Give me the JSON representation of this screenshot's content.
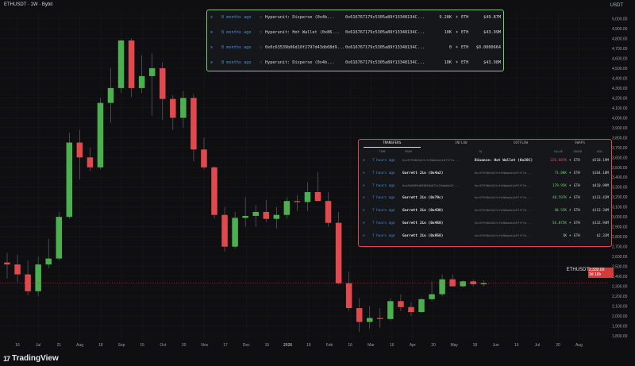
{
  "header": {
    "symbol": "ETHUSDT",
    "interval": "1W",
    "exchange": "Bybit",
    "title": "ETHUSDT · 1W · Bybit",
    "unit": "USDT"
  },
  "footer": {
    "brand": "TradingView"
  },
  "price_label": {
    "symbol": "ETHUSDT",
    "price": "2,332.00",
    "countdown": "3d 16h"
  },
  "chart_data": {
    "type": "candlestick",
    "title": "",
    "y_ticks": [
      "1,800.00",
      "1,900.00",
      "2,000.00",
      "2,100.00",
      "2,200.00",
      "2,300.00",
      "2,400.00",
      "2,500.00",
      "2,600.00",
      "2,700.00",
      "2,800.00",
      "2,900.00",
      "3,000.00",
      "3,100.00",
      "3,200.00",
      "3,300.00",
      "3,400.00",
      "3,500.00",
      "3,600.00",
      "3,700.00",
      "3,800.00",
      "3,900.00",
      "4,000.00",
      "4,100.00",
      "4,200.00",
      "4,300.00",
      "4,400.00",
      "4,500.00",
      "4,600.00",
      "4,700.00",
      "4,800.00",
      "4,900.00",
      "5,000.00"
    ],
    "ylim": [
      1760,
      5060
    ],
    "x_ticks": [
      "16",
      "Jul",
      "21",
      "Aug",
      "18",
      "Sep",
      "15",
      "Oct",
      "20",
      "Nov",
      "17",
      "Dec",
      "15",
      "2026",
      "19",
      "Feb",
      "16",
      "Mar",
      "16",
      "Apr",
      "20",
      "May",
      "18",
      "Jun",
      "15",
      "Jul",
      "20",
      "Aug"
    ],
    "candles": [
      {
        "o": 2540,
        "h": 2640,
        "l": 2380,
        "c": 2520
      },
      {
        "o": 2520,
        "h": 2620,
        "l": 2340,
        "c": 2420
      },
      {
        "o": 2420,
        "h": 2560,
        "l": 2210,
        "c": 2250
      },
      {
        "o": 2250,
        "h": 2600,
        "l": 2200,
        "c": 2520
      },
      {
        "o": 2520,
        "h": 2780,
        "l": 2480,
        "c": 2580
      },
      {
        "o": 2580,
        "h": 3050,
        "l": 2560,
        "c": 3000
      },
      {
        "o": 3000,
        "h": 3850,
        "l": 2980,
        "c": 3750
      },
      {
        "o": 3750,
        "h": 3880,
        "l": 3380,
        "c": 3600
      },
      {
        "o": 3600,
        "h": 3700,
        "l": 3460,
        "c": 3500
      },
      {
        "o": 3500,
        "h": 4200,
        "l": 3480,
        "c": 4150
      },
      {
        "o": 4150,
        "h": 4500,
        "l": 3950,
        "c": 4300
      },
      {
        "o": 4300,
        "h": 4790,
        "l": 4250,
        "c": 4780
      },
      {
        "o": 4780,
        "h": 4800,
        "l": 4210,
        "c": 4300
      },
      {
        "o": 4300,
        "h": 4630,
        "l": 4250,
        "c": 4420
      },
      {
        "o": 4420,
        "h": 4650,
        "l": 4020,
        "c": 4500
      },
      {
        "o": 4500,
        "h": 4560,
        "l": 3980,
        "c": 4190
      },
      {
        "o": 4190,
        "h": 4230,
        "l": 3880,
        "c": 4000
      },
      {
        "o": 4000,
        "h": 4270,
        "l": 3900,
        "c": 4200
      },
      {
        "o": 4200,
        "h": 4240,
        "l": 3560,
        "c": 3680
      },
      {
        "o": 3680,
        "h": 3800,
        "l": 3480,
        "c": 3500
      },
      {
        "o": 3500,
        "h": 3510,
        "l": 2980,
        "c": 3020
      },
      {
        "o": 3020,
        "h": 3100,
        "l": 2650,
        "c": 2700
      },
      {
        "o": 2700,
        "h": 3050,
        "l": 2680,
        "c": 2990
      },
      {
        "o": 2990,
        "h": 3200,
        "l": 2900,
        "c": 3010
      },
      {
        "o": 3010,
        "h": 3120,
        "l": 2900,
        "c": 3050
      },
      {
        "o": 3050,
        "h": 3170,
        "l": 2950,
        "c": 2980
      },
      {
        "o": 2980,
        "h": 3100,
        "l": 2880,
        "c": 3020
      },
      {
        "o": 3020,
        "h": 3200,
        "l": 2980,
        "c": 3160
      },
      {
        "o": 3160,
        "h": 3220,
        "l": 3060,
        "c": 3150
      },
      {
        "o": 3150,
        "h": 3350,
        "l": 3060,
        "c": 3250
      },
      {
        "o": 3250,
        "h": 3450,
        "l": 3200,
        "c": 3160
      },
      {
        "o": 3160,
        "h": 3250,
        "l": 2900,
        "c": 2940
      },
      {
        "o": 2940,
        "h": 3050,
        "l": 2320,
        "c": 2330
      },
      {
        "o": 2330,
        "h": 2450,
        "l": 2050,
        "c": 2080
      },
      {
        "o": 2080,
        "h": 2180,
        "l": 1840,
        "c": 1940
      },
      {
        "o": 1940,
        "h": 2100,
        "l": 1870,
        "c": 1980
      },
      {
        "o": 1980,
        "h": 2080,
        "l": 1880,
        "c": 1970
      },
      {
        "o": 1970,
        "h": 2180,
        "l": 1950,
        "c": 2150
      },
      {
        "o": 2150,
        "h": 2220,
        "l": 2050,
        "c": 2090
      },
      {
        "o": 2090,
        "h": 2140,
        "l": 2000,
        "c": 2040
      },
      {
        "o": 2040,
        "h": 2180,
        "l": 2030,
        "c": 2170
      },
      {
        "o": 2170,
        "h": 2350,
        "l": 2150,
        "c": 2220
      },
      {
        "o": 2220,
        "h": 2420,
        "l": 2200,
        "c": 2370
      },
      {
        "o": 2370,
        "h": 2420,
        "l": 2300,
        "c": 2300
      },
      {
        "o": 2300,
        "h": 2360,
        "l": 2290,
        "c": 2350
      },
      {
        "o": 2350,
        "h": 2370,
        "l": 2300,
        "c": 2320
      },
      {
        "o": 2320,
        "h": 2360,
        "l": 2300,
        "c": 2332
      }
    ]
  },
  "top_panel": {
    "rows": [
      {
        "age": "8 months ago",
        "from": "Hyperunit: Disperse (0x4b...",
        "to": "0x616767179c5305a89f1334813­4C...",
        "amount": "9.28K",
        "token": "ETH",
        "usd": "$49.87M"
      },
      {
        "age": "8 months ago",
        "from": "Hyperunit: Hot Wallet (0x86...",
        "to": "0x616767179c5305a89f13348134C...",
        "amount": "10K",
        "token": "ETH",
        "usd": "$43.99M"
      },
      {
        "age": "8 months ago",
        "from": "0x0c63539b06d10f2797d43db08d9...",
        "to": "0x616767179c5305a89f13348134C...",
        "amount": "0",
        "token": "ETH",
        "usd": "$0.0000664"
      },
      {
        "age": "8 months ago",
        "from": "Hyperunit: Disperse (0x4b...",
        "to": "0x616767179c5305a89f13348134C...",
        "amount": "10K",
        "token": "ETH",
        "usd": "$43.98M"
      }
    ]
  },
  "bottom_panel": {
    "tabs": [
      "TRANSFERS",
      "INFLOW",
      "OUTFLOW",
      "SWAPS"
    ],
    "columns": [
      "TIME",
      "FROM",
      "TO",
      "VALUE",
      "TOKEN",
      "USD"
    ],
    "rows": [
      {
        "age": "7 hours ago",
        "from": "0xc979f8b5d1fcfe9bba4a1e97ff7a...",
        "to": "Binance: Hot Wallet (0x28C)",
        "amount": "226.687K",
        "token": "ETH",
        "usd": "$518.19M",
        "amt_color": "red"
      },
      {
        "age": "7 hours ago",
        "from": "Garrett Jin (0x4a2)",
        "to": "0xc979f8b5d1fcfe9bba4a1e97ff7a...",
        "amount": "73.88K",
        "token": "ETH",
        "usd": "$164.10M",
        "amt_color": "green"
      },
      {
        "age": "7 hours ago",
        "from": "0xa3b5099d6636904672c26a0a6d2f...",
        "to": "0xc979f8b5d1fcfe9bba4a1e97ff7a...",
        "amount": "179.95K",
        "token": "ETH",
        "usd": "$410.99M",
        "amt_color": "green"
      },
      {
        "age": "7 hours ago",
        "from": "Garrett Jin (0x79c)",
        "to": "0xc979f8b5d1fcfe9bba4a1e97ff7a...",
        "amount": "48.597K",
        "token": "ETH",
        "usd": "$113.42M",
        "amt_color": "green"
      },
      {
        "age": "7 hours ago",
        "from": "Garrett Jin (0x430)",
        "to": "0xc979f8b5d1fcfe9bba4a1e97ff7a...",
        "amount": "48.55K",
        "token": "ETH",
        "usd": "$113.34M",
        "amt_color": "green"
      },
      {
        "age": "7 hours ago",
        "from": "Garrett Jin (0x458)",
        "to": "0xc979f8b5d1fcfe9bba4a1e97ff7a...",
        "amount": "56.875K",
        "token": "ETH",
        "usd": "$132.94M",
        "amt_color": "green"
      },
      {
        "age": "7 hours ago",
        "from": "Garrett Jin (0x958)",
        "to": "0xc979f8b5d1fcfe9bba4a1e97ff7a...",
        "amount": "1K",
        "token": "ETH",
        "usd": "$2.33M",
        "amt_color": "white"
      }
    ]
  },
  "colors": {
    "up": "#4caf50",
    "down": "#e04a4f",
    "panel_top_border": "#7ad07a",
    "panel_bottom_border": "#e0454f",
    "bg": "#0f0f11"
  }
}
